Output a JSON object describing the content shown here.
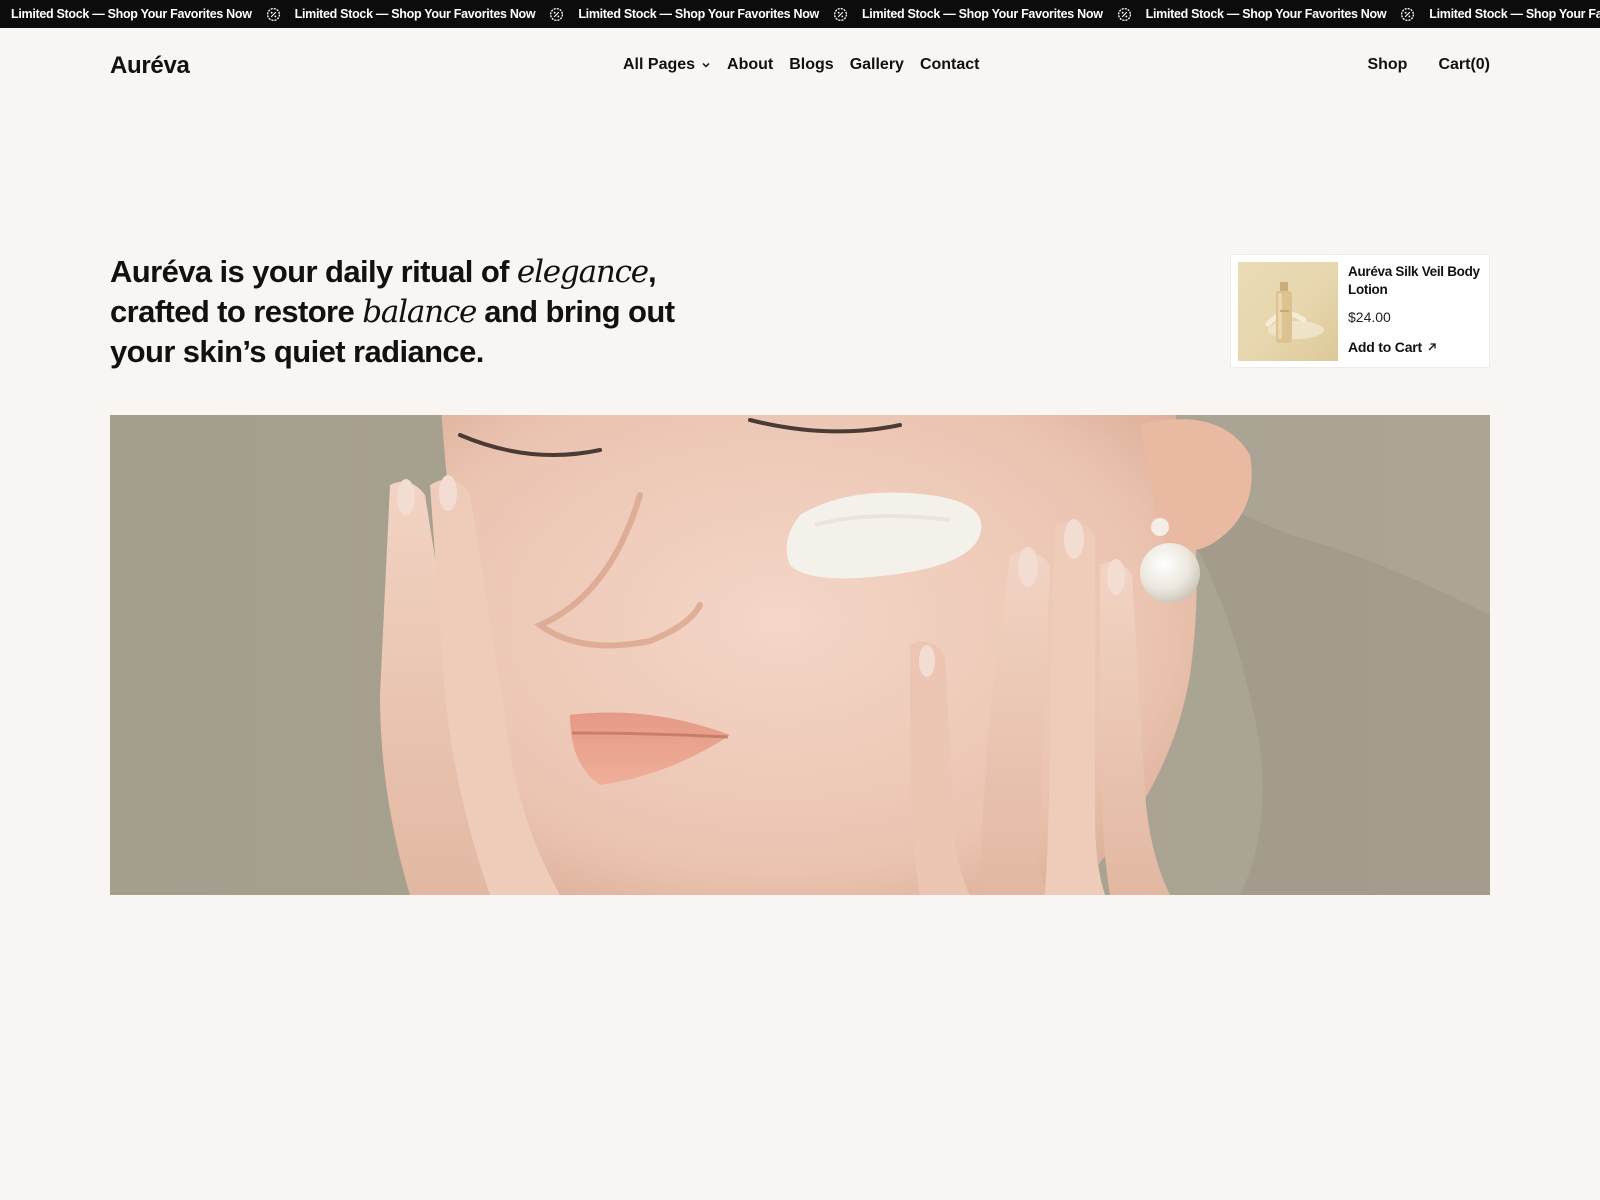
{
  "announcement": {
    "text": "Limited Stock — Shop Your Favorites Now",
    "icon": "discount-badge-icon",
    "background": "#0c0c0c",
    "color": "#ffffff"
  },
  "header": {
    "logo": "Auréva",
    "nav": [
      {
        "label": "All Pages",
        "has_dropdown": true
      },
      {
        "label": "About"
      },
      {
        "label": "Blogs"
      },
      {
        "label": "Gallery"
      },
      {
        "label": "Contact"
      }
    ],
    "shop_label": "Shop",
    "cart_label": "Cart(0)"
  },
  "hero": {
    "headline_part1": "Auréva is your daily ritual of ",
    "headline_em1": "elegance",
    "headline_part2": ", crafted to restore ",
    "headline_em2": "balance",
    "headline_part3": " and bring out your skin’s quiet radiance."
  },
  "product_card": {
    "name": "Auréva Silk Veil Body Lotion",
    "price": "$24.00",
    "cta": "Add to Cart",
    "cta_icon": "arrow-up-right-icon"
  },
  "colors": {
    "page_background": "#f8f5f2",
    "text": "#111111",
    "hero_background": "#a69f8e"
  }
}
